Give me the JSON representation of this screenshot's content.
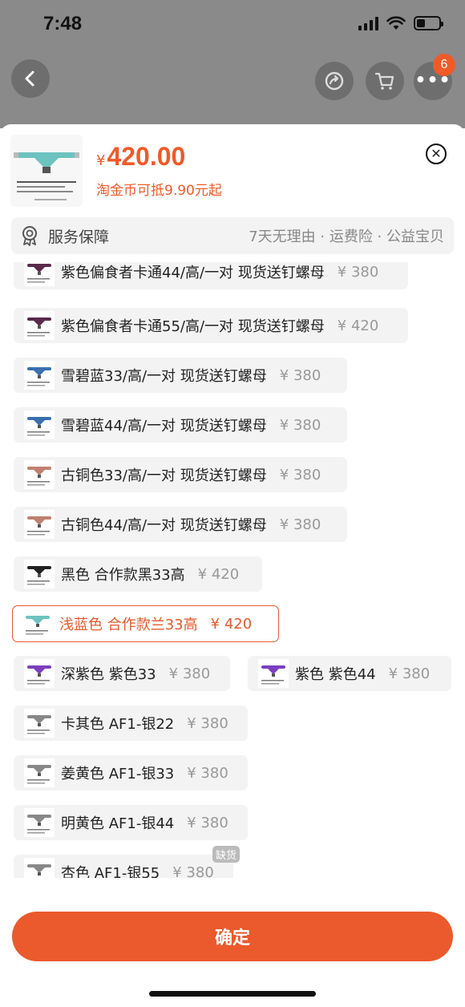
{
  "status": {
    "time": "7:48"
  },
  "nav": {
    "badge": "6"
  },
  "product": {
    "price_symbol": "¥",
    "price": "420.00",
    "coin_note": "淘金币可抵9.90元起"
  },
  "service": {
    "label": "服务保障",
    "desc": "7天无理由 · 运费险 · 公益宝贝"
  },
  "skus": [
    {
      "name": "紫色偏食者卡通44/高/一对 现货送钉螺母",
      "price": "¥ 380",
      "thumb_color": "#5a2a4a"
    },
    {
      "name": "紫色偏食者卡通55/高/一对 现货送钉螺母",
      "price": "¥ 420",
      "thumb_color": "#5a2a4a"
    },
    {
      "name": "雪碧蓝33/高/一对 现货送钉螺母",
      "price": "¥ 380",
      "thumb_color": "#3a6fb0"
    },
    {
      "name": "雪碧蓝44/高/一对 现货送钉螺母",
      "price": "¥ 380",
      "thumb_color": "#3a6fb0"
    },
    {
      "name": "古铜色33/高/一对 现货送钉螺母",
      "price": "¥ 380",
      "thumb_color": "#c08070"
    },
    {
      "name": "古铜色44/高/一对 现货送钉螺母",
      "price": "¥ 380",
      "thumb_color": "#c08070"
    },
    {
      "name": "黑色 合作款黑33高",
      "price": "¥ 420",
      "thumb_color": "#222222"
    },
    {
      "name": "浅蓝色 合作款兰33高",
      "price": "¥ 420",
      "thumb_color": "#6cc3c0",
      "selected": true
    },
    {
      "name": "深紫色 紫色33",
      "price": "¥ 380",
      "thumb_color": "#7b3fc0"
    },
    {
      "name": "紫色 紫色44",
      "price": "¥ 380",
      "thumb_color": "#7b3fc0"
    },
    {
      "name": "卡其色 AF1-银22",
      "price": "¥ 380",
      "thumb_color": "#888888"
    },
    {
      "name": "姜黄色 AF1-银33",
      "price": "¥ 380",
      "thumb_color": "#888888"
    },
    {
      "name": "明黄色 AF1-银44",
      "price": "¥ 380",
      "thumb_color": "#888888"
    },
    {
      "name": "杏色 AF1-银55",
      "price": "¥ 380",
      "thumb_color": "#888888",
      "tag": "缺货"
    }
  ],
  "confirm_label": "确定"
}
